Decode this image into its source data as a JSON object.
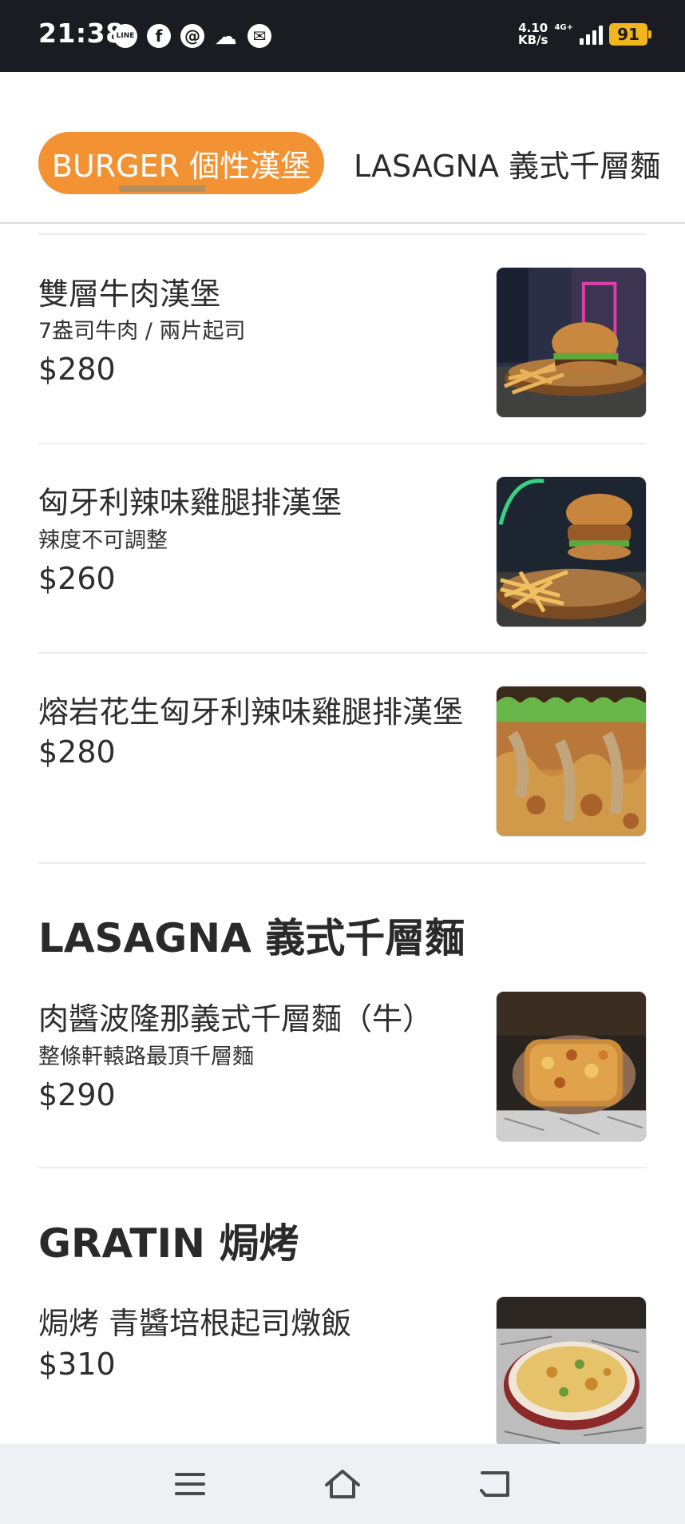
{
  "status_bar": {
    "time": "21:38",
    "apps": [
      {
        "icon": "line-icon",
        "label": "LINE"
      },
      {
        "icon": "facebook-icon",
        "label": "f"
      },
      {
        "icon": "threads-icon",
        "label": "@"
      },
      {
        "icon": "cloud-icon",
        "label": "☁"
      },
      {
        "icon": "messenger-icon",
        "label": "✉"
      }
    ],
    "net_speed_value": "4.10",
    "net_speed_unit": "KB/s",
    "net_type": "4G+",
    "battery": "91"
  },
  "tabs": [
    {
      "label": "BURGER 個性漢堡",
      "active": true
    },
    {
      "label": "LASAGNA 義式千層麵",
      "active": false
    }
  ],
  "menu": {
    "items": [
      {
        "name": "雙層牛肉漢堡",
        "desc": "7盎司牛肉 / 兩片起司",
        "price": "$280"
      },
      {
        "name": "匈牙利辣味雞腿排漢堡",
        "desc": "辣度不可調整",
        "price": "$260"
      },
      {
        "name": "熔岩花生匈牙利辣味雞腿排漢堡",
        "price": "$280"
      },
      {
        "name": "肉醬波隆那義式千層麵（牛）",
        "desc": "整條軒轅路最頂千層麵",
        "price": "$290"
      },
      {
        "name": "焗烤 青醬培根起司燉飯",
        "price": "$310"
      }
    ],
    "sections": [
      {
        "title": "LASAGNA 義式千層麵"
      },
      {
        "title": "GRATIN 焗烤"
      }
    ]
  },
  "nav_bar": {
    "buttons": [
      {
        "icon": "menu-icon"
      },
      {
        "icon": "home-icon"
      },
      {
        "icon": "back-icon"
      }
    ]
  },
  "colors": {
    "status_bar_bg": "#1b1c21",
    "tab_active_bg": "#f39233",
    "battery": "#f3b51e",
    "nav_bar_bg": "#eff0f4"
  }
}
